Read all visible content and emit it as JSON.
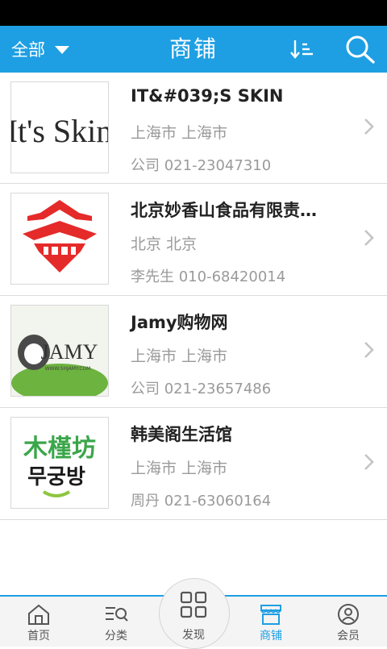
{
  "header": {
    "filter_label": "全部",
    "title": "商铺",
    "sort_icon": "sort-icon",
    "search_icon": "search-icon"
  },
  "shops": [
    {
      "name": "IT&#039;S SKIN",
      "city": "上海市 上海市",
      "contact": "公司 021-23047310",
      "logo_text": "It's Skin"
    },
    {
      "name": "北京妙香山食品有限责…",
      "city": "北京 北京",
      "contact": "李先生 010-68420014"
    },
    {
      "name": "Jamy购物网",
      "city": "上海市 上海市",
      "contact": "公司 021-23657486",
      "logo_text": "JAMY",
      "logo_url_text": "WWW.SHJAMY.COM"
    },
    {
      "name": "韩美阁生活馆",
      "city": "上海市 上海市",
      "contact": "周丹 021-63060164",
      "logo_text": "木槿坊",
      "logo_text_2": "무궁방"
    }
  ],
  "tabbar": {
    "home": "首页",
    "category": "分类",
    "discover": "发现",
    "shops": "商铺",
    "member": "会员"
  },
  "colors": {
    "accent": "#1e9fe3",
    "text_primary": "#222222",
    "text_secondary": "#9a9a9a"
  }
}
